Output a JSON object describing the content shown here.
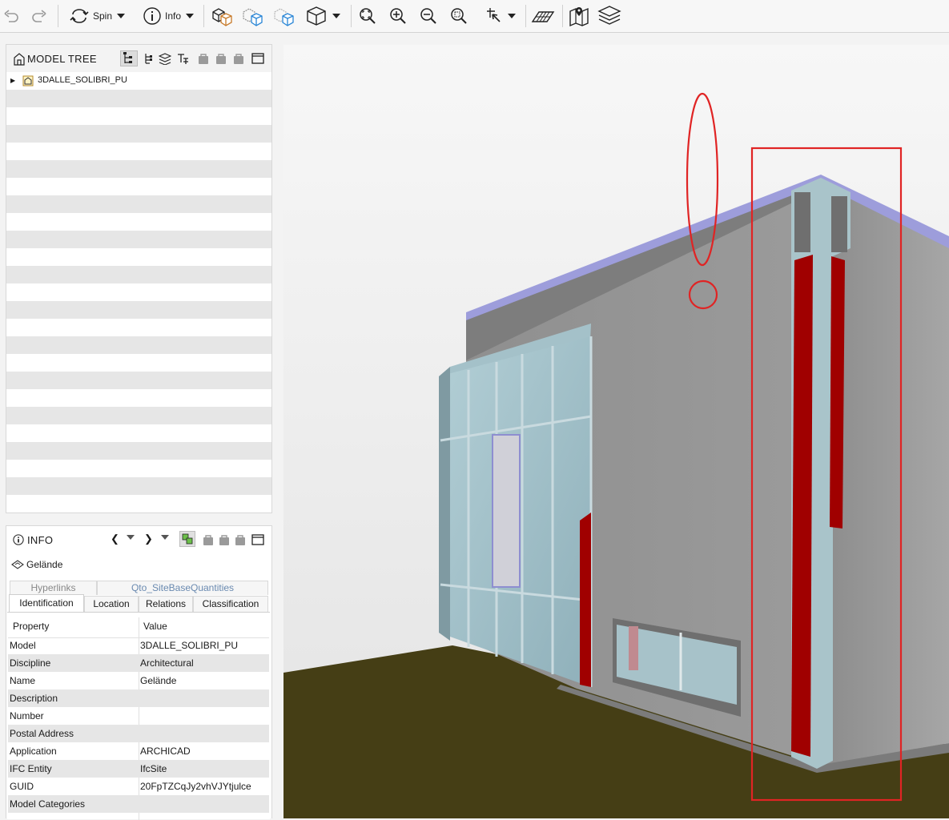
{
  "toolbar": {
    "spin_label": "Spin",
    "info_label": "Info"
  },
  "model_tree": {
    "title": "MODEL TREE",
    "root_item": "3DALLE_SOLIBRI_PU"
  },
  "info_panel": {
    "title": "INFO",
    "selected": "Gelände",
    "back_tabs": [
      "Hyperlinks",
      "Qto_SiteBaseQuantities"
    ],
    "tabs": [
      "Identification",
      "Location",
      "Relations",
      "Classification"
    ],
    "active_tab": "Identification",
    "columns": [
      "Property",
      "Value"
    ],
    "rows": [
      {
        "k": "Model",
        "v": "3DALLE_SOLIBRI_PU"
      },
      {
        "k": "Discipline",
        "v": "Architectural"
      },
      {
        "k": "Name",
        "v": "Gelände"
      },
      {
        "k": "Description",
        "v": ""
      },
      {
        "k": "Number",
        "v": ""
      },
      {
        "k": "Postal Address",
        "v": ""
      },
      {
        "k": "Application",
        "v": "ARCHICAD"
      },
      {
        "k": "IFC Entity",
        "v": "IfcSite"
      },
      {
        "k": "GUID",
        "v": "20FpTZCqJy2vhVJYtjulce"
      },
      {
        "k": "Model Categories",
        "v": ""
      }
    ]
  },
  "view": {
    "label": "3D"
  },
  "colors": {
    "highlight_red": "#e02424",
    "wall_grey": "#8a8a8a",
    "ground": "#463f15",
    "roof_edge": "#9a9ad6",
    "glass": "#a9c6cf",
    "issue_red": "#a00000"
  }
}
